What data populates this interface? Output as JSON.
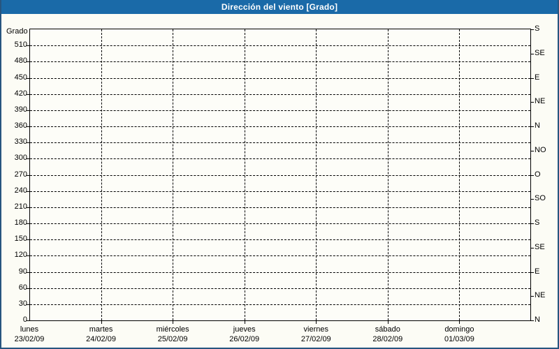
{
  "window": {
    "title": "Dirección del viento [Grado]"
  },
  "colors": {
    "title_bar": "#1a6aa8",
    "frame_border": "#27557f",
    "background": "#fcfcf5",
    "grid": "#000000",
    "text": "#000000",
    "title_text": "#ffffff"
  },
  "chart_data": {
    "type": "line",
    "title": "Dirección del viento [Grado]",
    "ylabel": "Grado",
    "xlabel": "",
    "ylim": [
      0,
      540
    ],
    "grid": true,
    "gridline_style": "dashed",
    "y_tick_step_left": 30,
    "y_ticks_left": [
      0,
      30,
      60,
      90,
      120,
      150,
      180,
      210,
      240,
      270,
      300,
      330,
      360,
      390,
      420,
      450,
      480,
      510
    ],
    "y_tick_step_right_deg": 45,
    "y_ticks_right": [
      {
        "deg": 0,
        "label": "N"
      },
      {
        "deg": 45,
        "label": "NE"
      },
      {
        "deg": 90,
        "label": "E"
      },
      {
        "deg": 135,
        "label": "SE"
      },
      {
        "deg": 180,
        "label": "S"
      },
      {
        "deg": 225,
        "label": "SO"
      },
      {
        "deg": 270,
        "label": "O"
      },
      {
        "deg": 315,
        "label": "NO"
      },
      {
        "deg": 360,
        "label": "N"
      },
      {
        "deg": 405,
        "label": "NE"
      },
      {
        "deg": 450,
        "label": "E"
      },
      {
        "deg": 495,
        "label": "SE"
      },
      {
        "deg": 540,
        "label": "S"
      }
    ],
    "x_categories": [
      {
        "day": "lunes",
        "date": "23/02/09"
      },
      {
        "day": "martes",
        "date": "24/02/09"
      },
      {
        "day": "miércoles",
        "date": "25/02/09"
      },
      {
        "day": "jueves",
        "date": "26/02/09"
      },
      {
        "day": "viernes",
        "date": "27/02/09"
      },
      {
        "day": "sábado",
        "date": "28/02/09"
      },
      {
        "day": "domingo",
        "date": "01/03/09"
      }
    ],
    "series": []
  }
}
